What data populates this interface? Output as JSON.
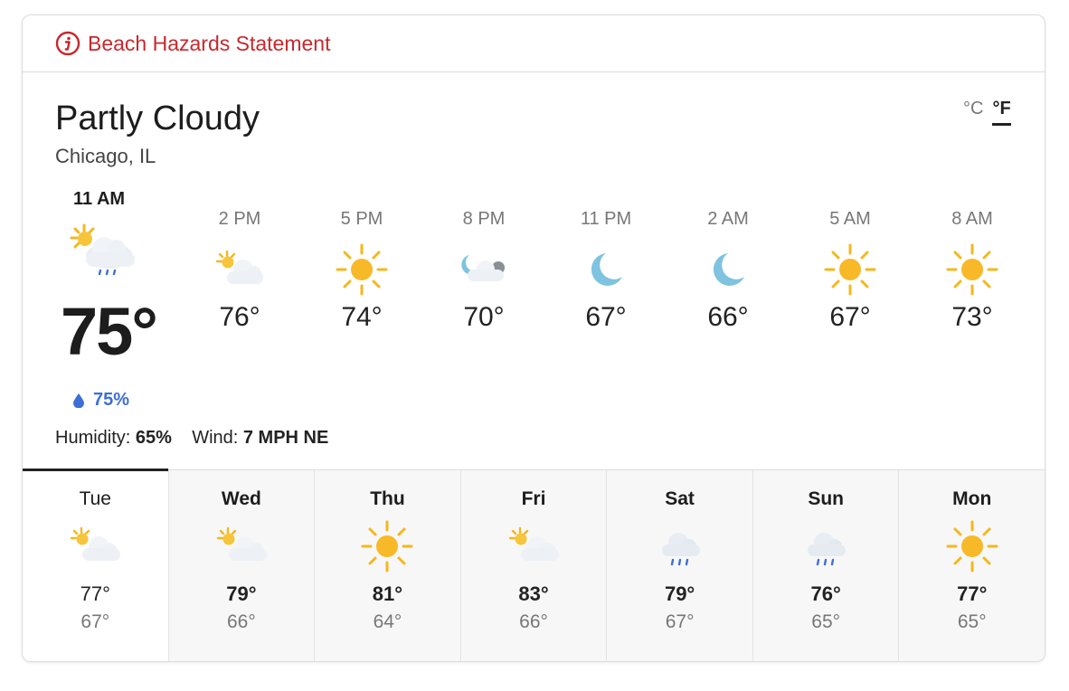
{
  "alert": {
    "label": "Beach Hazards Statement",
    "icon": "info-icon",
    "color": "#c8282d"
  },
  "current": {
    "condition": "Partly Cloudy",
    "location": "Chicago, IL",
    "time": "11 AM",
    "icon": "partly-cloudy-rain-icon",
    "temp": "75°",
    "precip": "75%",
    "humidity_label": "Humidity:",
    "humidity": "65%",
    "wind_label": "Wind:",
    "wind": "7 MPH NE"
  },
  "units": {
    "c": "°C",
    "f": "°F",
    "selected": "°F"
  },
  "hourly": [
    {
      "time": "2 PM",
      "icon": "partly-cloudy-icon",
      "temp": "76°"
    },
    {
      "time": "5 PM",
      "icon": "sun-icon",
      "temp": "74°"
    },
    {
      "time": "8 PM",
      "icon": "night-cloudy-icon",
      "temp": "70°"
    },
    {
      "time": "11 PM",
      "icon": "moon-icon",
      "temp": "67°"
    },
    {
      "time": "2 AM",
      "icon": "moon-icon",
      "temp": "66°"
    },
    {
      "time": "5 AM",
      "icon": "sun-icon",
      "temp": "67°"
    },
    {
      "time": "8 AM",
      "icon": "sun-icon",
      "temp": "73°"
    }
  ],
  "daily": [
    {
      "day": "Tue",
      "icon": "partly-cloudy-icon",
      "hi": "77°",
      "lo": "67°"
    },
    {
      "day": "Wed",
      "icon": "partly-cloudy-icon",
      "hi": "79°",
      "lo": "66°"
    },
    {
      "day": "Thu",
      "icon": "sun-icon",
      "hi": "81°",
      "lo": "64°"
    },
    {
      "day": "Fri",
      "icon": "partly-cloudy-icon",
      "hi": "83°",
      "lo": "66°"
    },
    {
      "day": "Sat",
      "icon": "rain-icon",
      "hi": "79°",
      "lo": "67°"
    },
    {
      "day": "Sun",
      "icon": "rain-icon",
      "hi": "76°",
      "lo": "65°"
    },
    {
      "day": "Mon",
      "icon": "sun-icon",
      "hi": "77°",
      "lo": "65°"
    }
  ]
}
